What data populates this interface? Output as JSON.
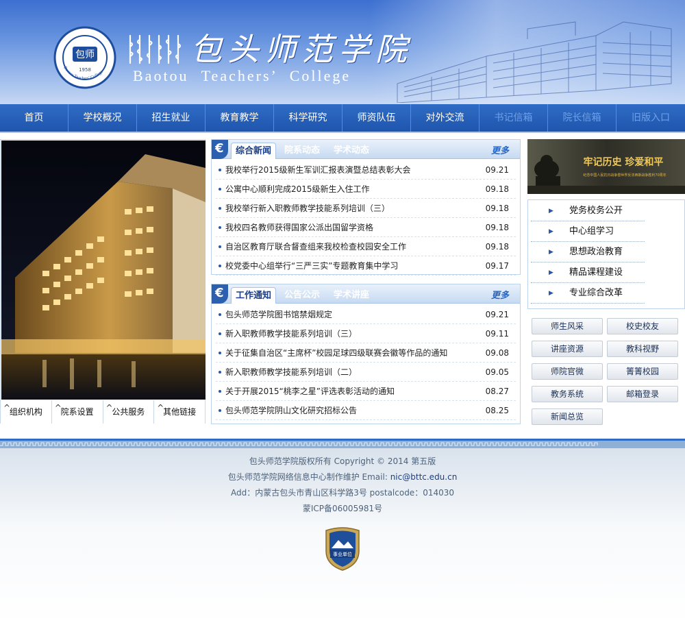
{
  "header": {
    "cn_name": "包头师范学院",
    "en_name": "Baotou Teachers’ College",
    "seal_year": "1958",
    "seal_en": "Baotou Teachers' College"
  },
  "nav": [
    {
      "label": "首页",
      "enabled": true
    },
    {
      "label": "学校概况",
      "enabled": true
    },
    {
      "label": "招生就业",
      "enabled": true
    },
    {
      "label": "教育教学",
      "enabled": true
    },
    {
      "label": "科学研究",
      "enabled": true
    },
    {
      "label": "师资队伍",
      "enabled": true
    },
    {
      "label": "对外交流",
      "enabled": true
    },
    {
      "label": "书记信箱",
      "enabled": false
    },
    {
      "label": "院长信箱",
      "enabled": false
    },
    {
      "label": "旧版入口",
      "enabled": false
    }
  ],
  "quicklinks": [
    "组织机构",
    "院系设置",
    "公共服务",
    "其他链接"
  ],
  "news": {
    "tabs": [
      "综合新闻",
      "院系动态",
      "学术动态"
    ],
    "more": "更多",
    "items": [
      {
        "title": "我校举行2015级新生军训汇报表演暨总结表彰大会",
        "date": "09.21"
      },
      {
        "title": "公寓中心顺利完成2015级新生入住工作",
        "date": "09.18"
      },
      {
        "title": "我校举行新入职教师教学技能系列培训（三）",
        "date": "09.18"
      },
      {
        "title": "我校四名教师获得国家公派出国留学资格",
        "date": "09.18"
      },
      {
        "title": "自治区教育厅联合督查组来我校检查校园安全工作",
        "date": "09.18"
      },
      {
        "title": "校党委中心组举行“三严三实”专题教育集中学习",
        "date": "09.17"
      }
    ]
  },
  "notices": {
    "tabs": [
      "工作通知",
      "公告公示",
      "学术讲座"
    ],
    "more": "更多",
    "items": [
      {
        "title": "包头师范学院图书馆禁烟规定",
        "date": "09.21"
      },
      {
        "title": "新入职教师教学技能系列培训（三）",
        "date": "09.11"
      },
      {
        "title": "关于征集自治区“主席杯”校园足球四级联赛会徽等作品的通知",
        "date": "09.08"
      },
      {
        "title": "新入职教师教学技能系列培训（二）",
        "date": "09.05"
      },
      {
        "title": "关于开展2015“桃李之星”评选表彰活动的通知",
        "date": "08.27"
      },
      {
        "title": "包头师范学院阴山文化研究招标公告",
        "date": "08.25"
      }
    ]
  },
  "banner": {
    "title": "牢记历史 珍爱和平",
    "subtitle": "纪念中国人民抗日战争暨世界反法西斯战争胜利70周年"
  },
  "side_menu": [
    "党务校务公开",
    "中心组学习",
    "思想政治教育",
    "精品课程建设",
    "专业综合改革"
  ],
  "quick_buttons": [
    "师生风采",
    "校史校友",
    "讲座资源",
    "教科视野",
    "师院官微",
    "箐箐校园",
    "教务系统",
    "邮箱登录",
    "新闻总览"
  ],
  "footer": {
    "copyright": "包头师范学院版权所有 Copyright © 2014 第五版",
    "maintainer": "包头师范学院网络信息中心制作维护",
    "email_label": "Email:",
    "email": "nic@bttc.edu.cn",
    "address": "Add：内蒙古包头市青山区科学路3号  postalcode：014030",
    "icp": "蒙ICP备06005981号",
    "badge": "事业单位"
  },
  "colors": {
    "header": "#3c6fd0",
    "nav": "#1f55ad",
    "accent": "#2766c4",
    "text_dark": "#1b3e86"
  }
}
